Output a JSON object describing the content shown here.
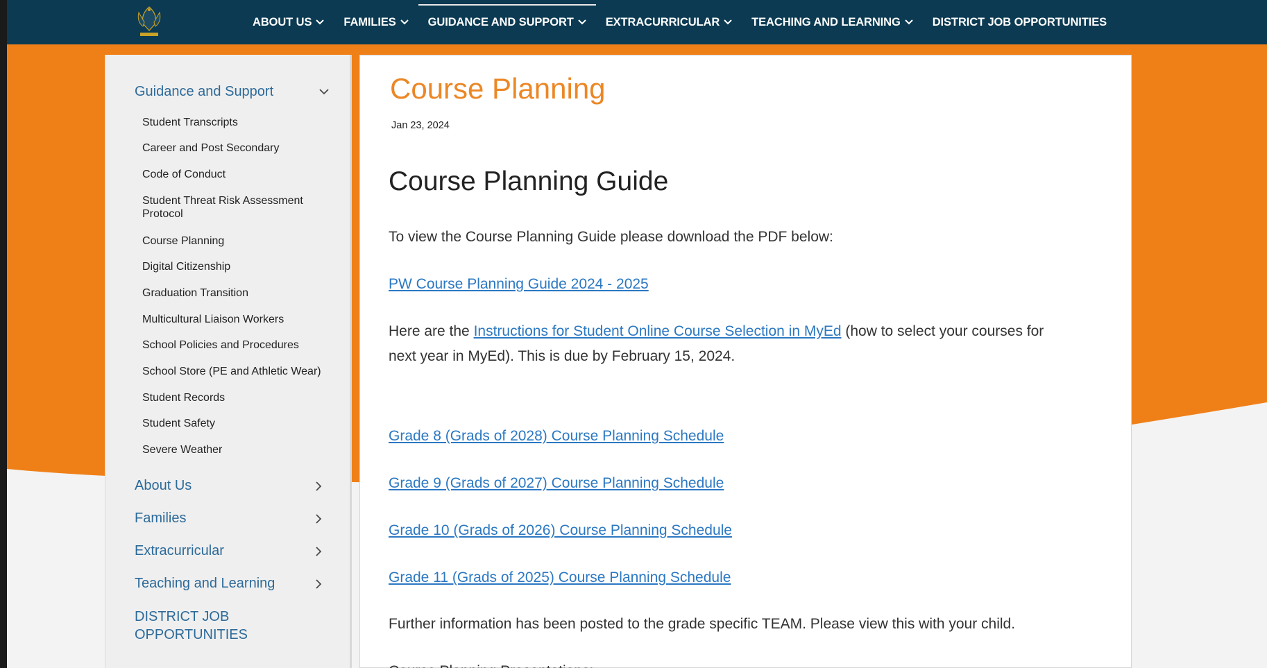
{
  "nav": {
    "items": [
      {
        "label": "ABOUT US",
        "has_menu": true
      },
      {
        "label": "FAMILIES",
        "has_menu": true
      },
      {
        "label": "GUIDANCE AND SUPPORT",
        "has_menu": true
      },
      {
        "label": "EXTRACURRICULAR",
        "has_menu": true
      },
      {
        "label": "TEACHING AND LEARNING",
        "has_menu": true
      },
      {
        "label": "DISTRICT JOB OPPORTUNITIES",
        "has_menu": false
      }
    ],
    "active_index": 2
  },
  "sidebar": {
    "section_title": "Guidance and Support",
    "sub_items": [
      "Student Transcripts",
      "Career and Post Secondary",
      "Code of Conduct",
      "Student Threat Risk Assessment Protocol",
      "Course Planning",
      "Digital Citizenship",
      "Graduation Transition",
      "Multicultural Liaison Workers",
      "School Policies and Procedures",
      "School Store (PE and Athletic Wear)",
      "Student Records",
      "Student Safety",
      "Severe Weather"
    ],
    "main_items": [
      "About Us",
      "Families",
      "Extracurricular",
      "Teaching and Learning",
      "DISTRICT JOB OPPORTUNITIES"
    ]
  },
  "content": {
    "title": "Course Planning",
    "date": "Jan 23, 2024",
    "heading": "Course Planning Guide",
    "intro": "To view the Course Planning Guide please download the PDF below:",
    "guide_link": "PW Course Planning Guide 2024 - 2025",
    "instr_before": "Here are the ",
    "instr_link": "Instructions for Student Online Course Selection in MyEd",
    "instr_after": " (how to select your courses for next year in MyEd). This is due by February 15, 2024.",
    "schedule_links": [
      "Grade 8 (Grads of 2028) Course Planning Schedule",
      "Grade 9 (Grads of 2027) Course Planning Schedule",
      "Grade 10 (Grads of 2026) Course Planning Schedule",
      "Grade 11 (Grads of 2025) Course Planning Schedule"
    ],
    "further_info": "Further information has been posted to the grade specific TEAM. Please view this with your child.",
    "presentations": "Course Planning Presentations:"
  },
  "colors": {
    "nav_bg": "#0b3a52",
    "accent_orange": "#ec8725",
    "link_blue": "#2b78c2",
    "sidebar_link": "#2d6a99"
  }
}
